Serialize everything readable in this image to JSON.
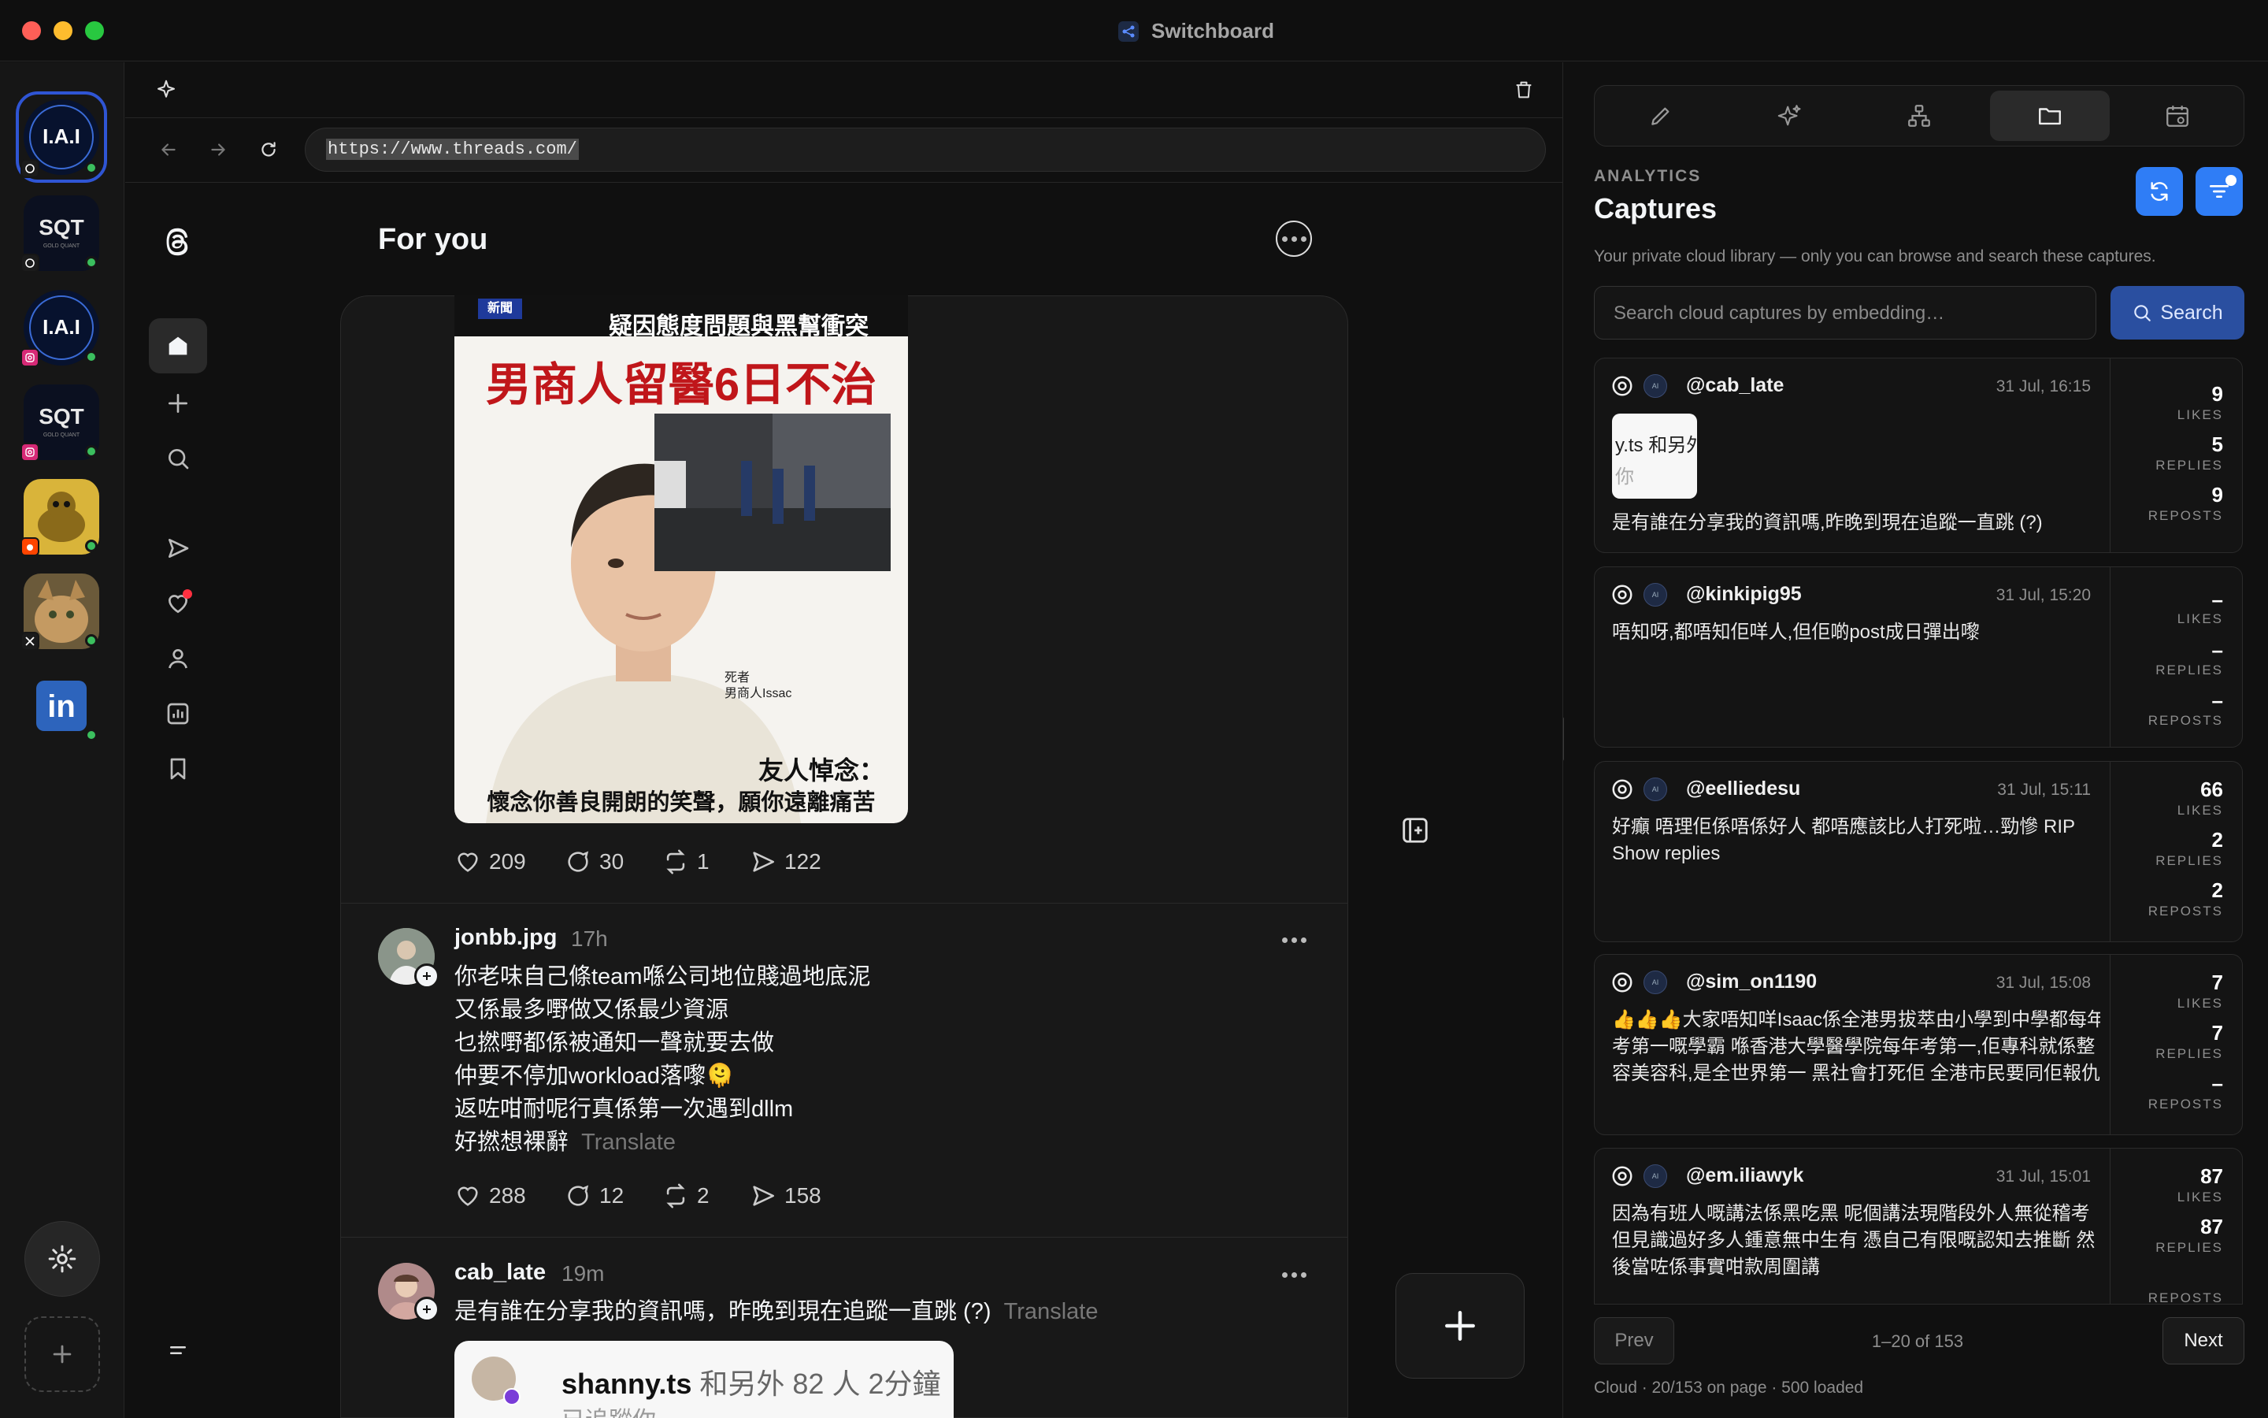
{
  "window": {
    "title": "Switchboard"
  },
  "browser": {
    "url": "https://www.threads.com/"
  },
  "feed": {
    "heading": "For you",
    "image_post": {
      "image_top_line": "疑因態度問題與黑幫衝突",
      "image_badge": "新聞",
      "image_headline": "男商人留醫6日不治",
      "image_caption_small": "死者\n男商人Issac",
      "image_quote_title": "友人悼念：",
      "image_quote": "懷念你善良開朗的笑聲，願你遠離痛苦",
      "likes": "209",
      "replies": "30",
      "reposts": "1",
      "shares": "122"
    },
    "posts": [
      {
        "user": "jonbb.jpg",
        "time": "17h",
        "lines": [
          "你老味自己條team喺公司地位賤過地底泥",
          "又係最多嘢做又係最少資源",
          "乜撚嘢都係被通知一聲就要去做",
          "仲要不停加workload落嚟🫠",
          "返咗咁耐呢行真係第一次遇到dllm",
          "好撚想裸辭"
        ],
        "translate": "Translate",
        "likes": "288",
        "replies": "12",
        "reposts": "2",
        "shares": "158"
      },
      {
        "user": "cab_late",
        "time": "19m",
        "text": "是有誰在分享我的資訊嗎，昨晚到現在追蹤一直跳 (?)",
        "translate": "Translate",
        "embed_name": "shanny.ts",
        "embed_rest": "和另外 82 人 2分鐘",
        "embed_sub": "已追蹤你"
      }
    ]
  },
  "panel": {
    "section_label": "ANALYTICS",
    "title": "Captures",
    "description": "Your private cloud library — only you can browse and search these captures.",
    "search_placeholder": "Search cloud captures by embedding…",
    "search_button": "Search",
    "metric_labels": {
      "likes": "LIKES",
      "replies": "REPLIES",
      "reposts": "REPOSTS"
    },
    "captures": [
      {
        "handle": "@cab_late",
        "time": "31 Jul, 16:15",
        "thumb_line1": "y.ts 和另外",
        "thumb_line2": "你",
        "text": "是有誰在分享我的資訊嗎,昨晚到現在追蹤一直跳 (?)",
        "likes": "9",
        "replies": "5",
        "reposts": "9"
      },
      {
        "handle": "@kinkipig95",
        "time": "31 Jul, 15:20",
        "text": "唔知呀,都唔知佢咩人,但佢啲post成日彈出嚟",
        "likes": "–",
        "replies": "–",
        "reposts": "–"
      },
      {
        "handle": "@eelliedesu",
        "time": "31 Jul, 15:11",
        "text": "好癲 唔理佢係唔係好人 都唔應該比人打死啦…勁慘 RIP",
        "text2": "Show replies",
        "likes": "66",
        "replies": "2",
        "reposts": "2"
      },
      {
        "handle": "@sim_on1190",
        "time": "31 Jul, 15:08",
        "text": "👍👍👍大家唔知咩Isaac係全港男拔萃由小學到中學都每年",
        "text2": "考第一嘅學霸 喺香港大學醫學院每年考第一,佢專科就係整",
        "text3": "容美容科,是全世界第一 黑社會打死佢 全港市民要同佢報仇…",
        "likes": "7",
        "replies": "7",
        "reposts": "–"
      },
      {
        "handle": "@em.iliawyk",
        "time": "31 Jul, 15:01",
        "text": "因為有班人嘅講法係黑吃黑 呢個講法現階段外人無從稽考",
        "text2": "但見識過好多人鍾意無中生有 憑自己有限嘅認知去推斷 然",
        "text3": "後當咗係事實咁款周圍講",
        "likes": "87",
        "replies": "87",
        "reposts": ""
      }
    ],
    "pagination": {
      "prev": "Prev",
      "info": "1–20 of 153",
      "next": "Next"
    },
    "footer": "Cloud · 20/153 on page · 500 loaded"
  },
  "colors": {
    "accent": "#2f7df6",
    "online": "#3bbf5e",
    "like_dot": "#ff3040"
  }
}
